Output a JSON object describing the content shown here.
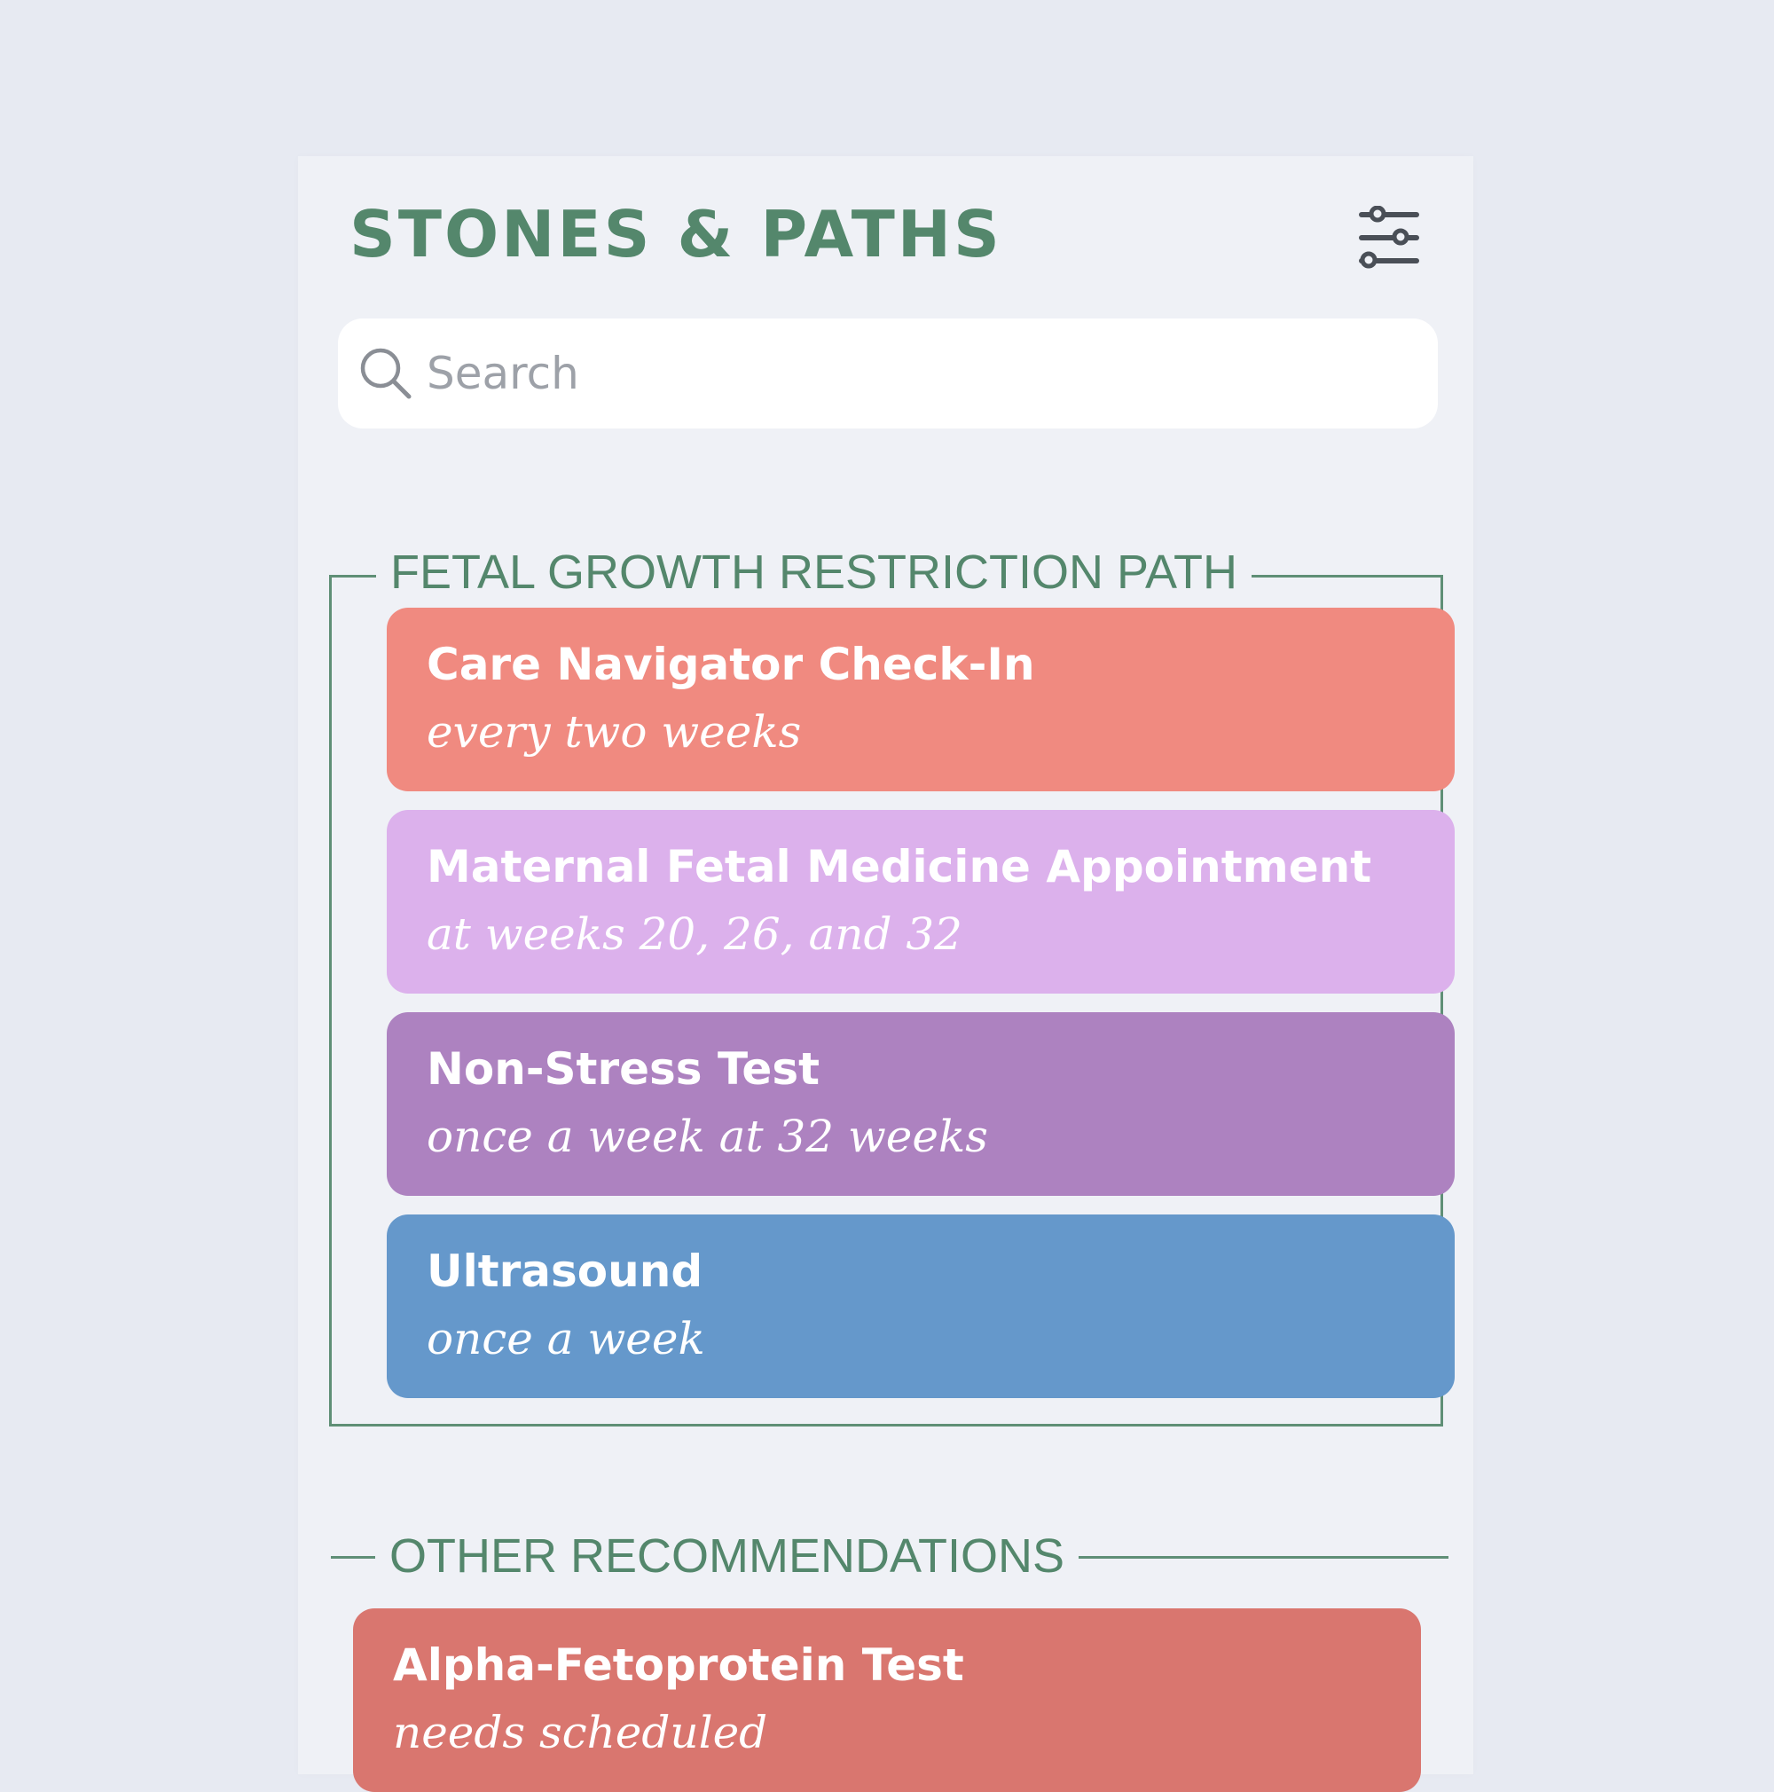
{
  "header": {
    "title": "STONES & PATHS",
    "filter_icon": "sliders-icon"
  },
  "search": {
    "icon": "search-icon",
    "placeholder": "Search",
    "value": ""
  },
  "path_section": {
    "title": "FETAL GROWTH RESTRICTION PATH",
    "items": [
      {
        "title": "Care Navigator Check-In",
        "subtitle": "every two weeks",
        "color": "#f08a80"
      },
      {
        "title": "Maternal Fetal Medicine Appointment",
        "subtitle": "at weeks 20, 26, and 32",
        "color": "#dcb1ec"
      },
      {
        "title": "Non-Stress Test",
        "subtitle": "once a week at 32 weeks",
        "color": "#ad82c0"
      },
      {
        "title": "Ultrasound",
        "subtitle": "once a week",
        "color": "#6598cb"
      }
    ]
  },
  "other_section": {
    "title": "OTHER RECOMMENDATIONS",
    "items": [
      {
        "title": "Alpha-Fetoprotein Test",
        "subtitle": "needs scheduled",
        "color": "#d9766f"
      }
    ]
  },
  "colors": {
    "page_background": "#e7eaf2",
    "panel_background": "#eff1f6",
    "accent_green": "#54876c"
  }
}
